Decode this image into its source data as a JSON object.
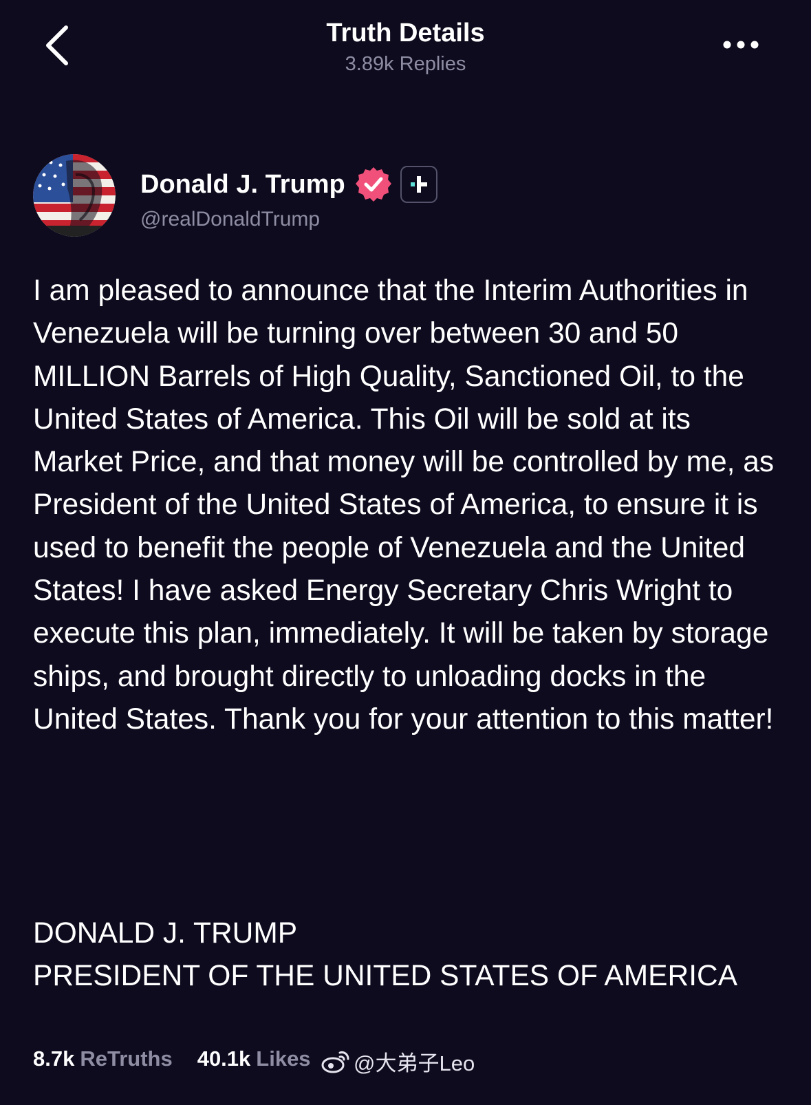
{
  "header": {
    "title": "Truth Details",
    "subtitle": "3.89k Replies"
  },
  "icons": {
    "back": "chevron-left-icon",
    "more": "ellipsis-horizontal-icon",
    "verified": "verified-badge-icon",
    "follow": "follow-plus-icon",
    "watermark": "weibo-icon"
  },
  "author": {
    "display_name": "Donald J. Trump",
    "handle": "@realDonaldTrump"
  },
  "post": {
    "body": "I am pleased to announce that the Interim Authorities in Venezuela will be turning over between 30 and 50 MILLION Barrels of High Quality, Sanctioned Oil, to the United States of America. This Oil will be sold at its Market Price, and that money will be controlled by me, as President of the United States of America, to ensure it is used to benefit the people of Venezuela and the United States! I have asked Energy Secretary Chris Wright to execute this plan, immediately. It will be taken by storage ships, and brought directly to unloading docks in the United States. Thank you for your attention to this matter!",
    "signature_line1": "DONALD J. TRUMP",
    "signature_line2": "PRESIDENT OF THE UNITED STATES OF AMERICA"
  },
  "stats": {
    "retruths_count": "8.7k",
    "retruths_label": "ReTruths",
    "likes_count": "40.1k",
    "likes_label": "Likes"
  },
  "watermark": {
    "text": "@大弟子Leo"
  },
  "colors": {
    "background": "#0d0b1d",
    "muted_text": "#8f8da3",
    "verified_badge": "#f1507a",
    "follow_accent": "#5ee0d8"
  }
}
